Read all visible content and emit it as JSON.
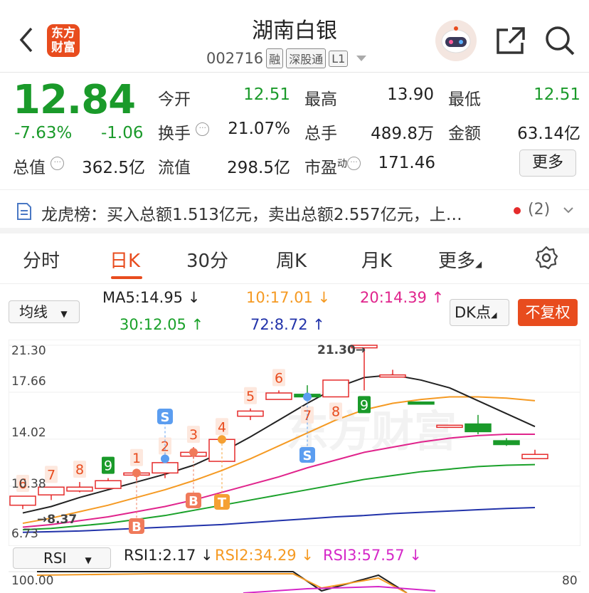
{
  "header": {
    "title": "湖南白银",
    "code": "002716",
    "tags": [
      "融",
      "深股通",
      "L1"
    ],
    "logo_line1": "东方",
    "logo_line2": "财富"
  },
  "quote": {
    "price": "12.84",
    "change_pct": "-7.63%",
    "change": "-1.06",
    "total_value_label": "总值",
    "total_value": "362.5亿",
    "fields": {
      "open_label": "今开",
      "open": "12.51",
      "high_label": "最高",
      "high": "13.90",
      "low_label": "最低",
      "low": "12.51",
      "turnover_label": "换手",
      "turnover": "21.07%",
      "volume_label": "总手",
      "volume": "489.8万",
      "amount_label": "金额",
      "amount": "63.14亿",
      "float_label": "流值",
      "float": "298.5亿",
      "pe_label": "市盈",
      "pe_sup": "动",
      "pe": "171.46"
    },
    "more_button": "更多"
  },
  "dragon_tiger": {
    "text": "龙虎榜：买入总额1.513亿元，卖出总额2.557亿元，上…",
    "count": "(2)"
  },
  "tabs": [
    "分时",
    "日K",
    "30分",
    "周K",
    "月K",
    "更多"
  ],
  "active_tab": "日K",
  "ma": {
    "selector": "均线",
    "ma5": "MA5:14.95 ↓",
    "ma10": "10:17.01 ↓",
    "ma20": "20:14.39 ↑",
    "ma30": "30:12.05 ↑",
    "ma72": "72:8.72 ↑",
    "dk_button": "DK点",
    "adjust_button": "不复权",
    "colors": {
      "ma5": "#222222",
      "ma10": "#f59a23",
      "ma20": "#e0248c",
      "ma30": "#1aa12a",
      "ma72": "#2233aa"
    }
  },
  "chart_axis": {
    "y_ticks": [
      "21.30",
      "17.66",
      "14.02",
      "10.38",
      "6.73"
    ],
    "max_label": "21.30",
    "min_label": "8.37"
  },
  "candle_labels": [
    "6",
    "7",
    "8",
    "9",
    "1",
    "2",
    "3",
    "4",
    "5",
    "6",
    "7",
    "8",
    "9"
  ],
  "signal_labels": [
    "B",
    "S",
    "B",
    "T",
    "S"
  ],
  "chart_data": {
    "type": "candlestick",
    "y_range": [
      6.73,
      21.3
    ],
    "candles": [
      {
        "o": 8.9,
        "c": 9.6,
        "h": 9.6,
        "l": 8.6
      },
      {
        "o": 9.7,
        "c": 10.3,
        "h": 10.3,
        "l": 9.3
      },
      {
        "o": 10.0,
        "c": 10.3,
        "h": 10.7,
        "l": 9.9
      },
      {
        "o": 10.2,
        "c": 10.8,
        "h": 11.0,
        "l": 10.2
      },
      {
        "o": 11.3,
        "c": 11.4,
        "h": 11.6,
        "l": 10.8
      },
      {
        "o": 11.4,
        "c": 12.2,
        "h": 12.5,
        "l": 11.0
      },
      {
        "o": 12.7,
        "c": 13.0,
        "h": 13.4,
        "l": 12.5
      },
      {
        "o": 12.3,
        "c": 14.0,
        "h": 14.0,
        "l": 12.3
      },
      {
        "o": 15.8,
        "c": 16.2,
        "h": 16.4,
        "l": 15.5
      },
      {
        "o": 17.1,
        "c": 17.6,
        "h": 17.8,
        "l": 17.1
      },
      {
        "o": 17.5,
        "c": 17.3,
        "h": 18.2,
        "l": 17.0
      },
      {
        "o": 17.3,
        "c": 18.6,
        "h": 18.6,
        "l": 17.3
      },
      {
        "o": 21.1,
        "c": 21.3,
        "h": 21.3,
        "l": 17.8
      },
      {
        "o": 18.9,
        "c": 19.0,
        "h": 19.4,
        "l": 18.9
      },
      {
        "o": 16.9,
        "c": 16.8,
        "h": 16.9,
        "l": 16.8
      },
      {
        "o": 15.1,
        "c": 15.1,
        "h": 15.1,
        "l": 15.1
      },
      {
        "o": 15.2,
        "c": 14.6,
        "h": 15.9,
        "l": 14.4
      },
      {
        "o": 13.9,
        "c": 13.6,
        "h": 14.1,
        "l": 13.5
      },
      {
        "o": 12.51,
        "c": 12.84,
        "h": 13.2,
        "l": 12.51
      }
    ],
    "ma5": [
      8.3,
      8.8,
      9.5,
      10.1,
      10.7,
      11.3,
      12.0,
      13.0,
      14.2,
      15.5,
      16.8,
      18.0,
      18.8,
      19.0,
      18.6,
      18.0,
      17.0,
      16.0,
      15.0
    ],
    "ma10": [
      7.5,
      7.9,
      8.4,
      8.9,
      9.5,
      10.1,
      10.8,
      11.6,
      12.5,
      13.5,
      14.5,
      15.5,
      16.3,
      16.8,
      17.1,
      17.3,
      17.3,
      17.2,
      17.0
    ],
    "ma20": [
      7.2,
      7.4,
      7.7,
      8.0,
      8.4,
      8.8,
      9.3,
      9.9,
      10.5,
      11.1,
      11.8,
      12.4,
      13.0,
      13.4,
      13.8,
      14.1,
      14.3,
      14.4,
      14.4
    ],
    "ma30": [
      7.0,
      7.1,
      7.3,
      7.5,
      7.8,
      8.1,
      8.5,
      8.9,
      9.3,
      9.7,
      10.1,
      10.5,
      10.9,
      11.2,
      11.5,
      11.7,
      11.9,
      12.0,
      12.05
    ],
    "ma72": [
      6.8,
      6.85,
      6.9,
      7.0,
      7.1,
      7.2,
      7.3,
      7.4,
      7.55,
      7.7,
      7.85,
      8.0,
      8.1,
      8.25,
      8.35,
      8.45,
      8.55,
      8.65,
      8.72
    ]
  },
  "rsi": {
    "selector": "RSI",
    "rsi1": "RSI1:2.17 ↓",
    "rsi2": "RSI2:34.29 ↓",
    "rsi3": "RSI3:57.57 ↓",
    "top_label": "100.00",
    "right_label": "80"
  }
}
